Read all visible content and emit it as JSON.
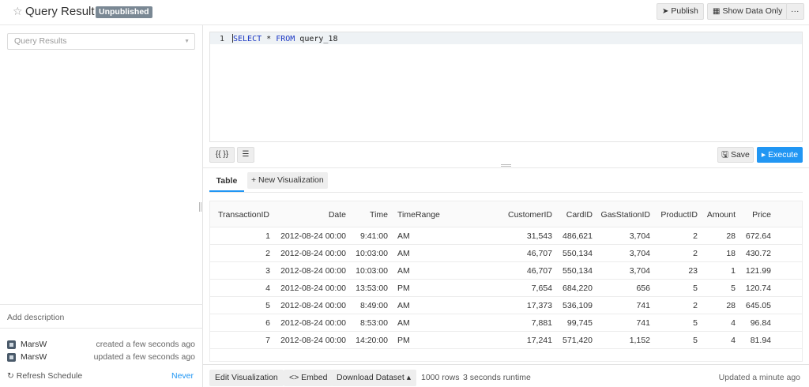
{
  "header": {
    "title": "Query Result",
    "badge": "Unpublished",
    "publish_label": "Publish",
    "show_data_label": "Show Data Only",
    "more_label": "···"
  },
  "left": {
    "select_placeholder": "Query Results",
    "add_description": "Add description",
    "meta": [
      {
        "user": "MarsW",
        "text": "created a few seconds ago"
      },
      {
        "user": "MarsW",
        "text": "updated a few seconds ago"
      }
    ],
    "refresh_label": "Refresh Schedule",
    "refresh_value": "Never"
  },
  "editor": {
    "line_number": "1",
    "kw1": "SELECT",
    "star": " * ",
    "kw2": "FROM",
    "rest": " query_18",
    "params_label": "{{ }}",
    "format_label": "☰",
    "save_label": "Save",
    "execute_label": "Execute"
  },
  "tabs": {
    "table_label": "Table",
    "new_viz_label": "+ New Visualization"
  },
  "table": {
    "columns": [
      "TransactionID",
      "Date",
      "Time",
      "TimeRange",
      "CustomerID",
      "CardID",
      "GasStationID",
      "ProductID",
      "Amount",
      "Price"
    ],
    "rows": [
      [
        "1",
        "2012-08-24 00:00",
        "9:41:00",
        "AM",
        "31,543",
        "486,621",
        "3,704",
        "2",
        "28",
        "672.64"
      ],
      [
        "2",
        "2012-08-24 00:00",
        "10:03:00",
        "AM",
        "46,707",
        "550,134",
        "3,704",
        "2",
        "18",
        "430.72"
      ],
      [
        "3",
        "2012-08-24 00:00",
        "10:03:00",
        "AM",
        "46,707",
        "550,134",
        "3,704",
        "23",
        "1",
        "121.99"
      ],
      [
        "4",
        "2012-08-24 00:00",
        "13:53:00",
        "PM",
        "7,654",
        "684,220",
        "656",
        "5",
        "5",
        "120.74"
      ],
      [
        "5",
        "2012-08-24 00:00",
        "8:49:00",
        "AM",
        "17,373",
        "536,109",
        "741",
        "2",
        "28",
        "645.05"
      ],
      [
        "6",
        "2012-08-24 00:00",
        "8:53:00",
        "AM",
        "7,881",
        "99,745",
        "741",
        "5",
        "4",
        "96.84"
      ],
      [
        "7",
        "2012-08-24 00:00",
        "14:20:00",
        "PM",
        "17,241",
        "571,420",
        "1,152",
        "5",
        "4",
        "81.94"
      ]
    ]
  },
  "footer": {
    "edit_viz_label": "Edit Visualization",
    "embed_label": "<> Embed",
    "download_label": "Download Dataset ▴",
    "rows_count": "1000 rows",
    "runtime": "3 seconds runtime",
    "updated": "Updated a minute ago"
  }
}
